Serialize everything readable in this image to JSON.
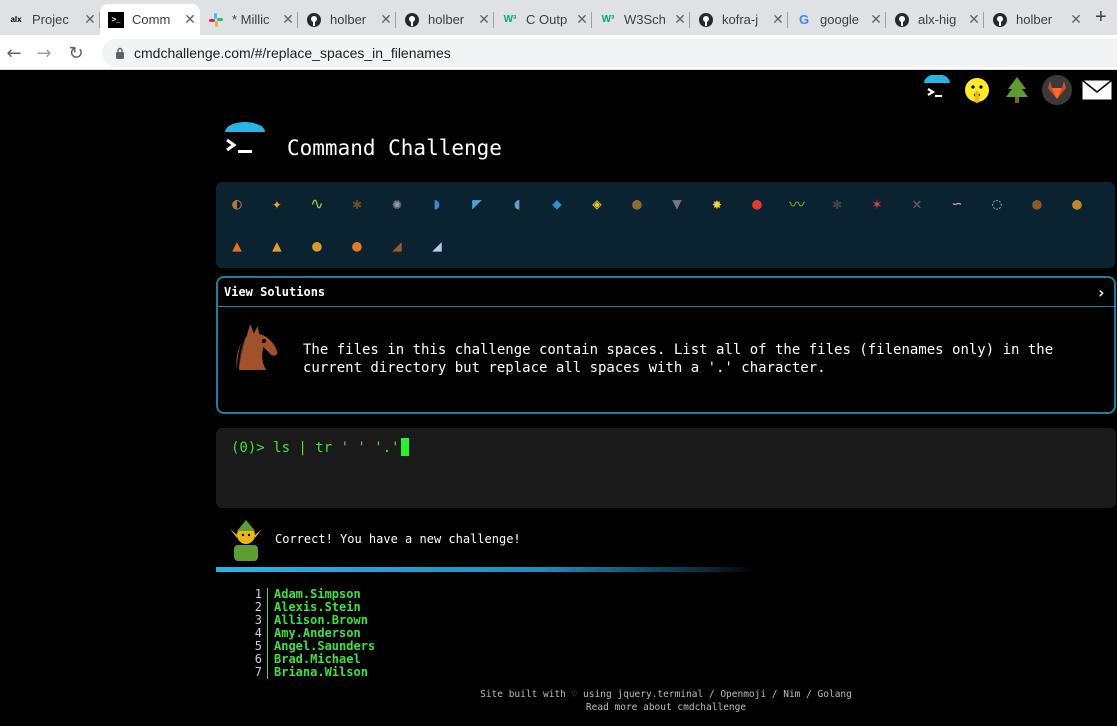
{
  "browser": {
    "tabs": [
      {
        "title": "Projec",
        "favicon": "alx-logo",
        "fav_text": "alx"
      },
      {
        "title": "Comm",
        "favicon": "terminal-logo",
        "fav_text": ">_"
      },
      {
        "title": "* Millic",
        "favicon": "slack-logo",
        "fav_text": ""
      },
      {
        "title": "holber",
        "favicon": "github-logo",
        "fav_text": ""
      },
      {
        "title": "holber",
        "favicon": "github-logo",
        "fav_text": ""
      },
      {
        "title": "C Outp",
        "favicon": "w3schools-logo",
        "fav_text": "W³"
      },
      {
        "title": "W3Sch",
        "favicon": "w3schools-logo",
        "fav_text": "W³"
      },
      {
        "title": "kofra-j",
        "favicon": "github-logo",
        "fav_text": ""
      },
      {
        "title": "google",
        "favicon": "google-logo",
        "fav_text": "G"
      },
      {
        "title": "alx-hig",
        "favicon": "github-logo",
        "fav_text": ""
      },
      {
        "title": "holber",
        "favicon": "github-logo",
        "fav_text": ""
      }
    ],
    "active_tab": 1,
    "new_tab": "+",
    "url": "cmdchallenge.com/#/replace_spaces_in_filenames"
  },
  "header": {
    "title": "Command Challenge",
    "top_icons": [
      "terminal-icon",
      "shushing-face-icon",
      "tree-icon",
      "gitlab-icon",
      "envelope-icon"
    ]
  },
  "emoji_bar": {
    "row1": [
      "snail",
      "butterfly",
      "caterpillar",
      "ant",
      "spider-web",
      "whale",
      "shark",
      "dolphin",
      "fish",
      "tropical-fish",
      "blowfish",
      "wolf",
      "bee",
      "ladybug",
      "lizard",
      "spider",
      "scorpion",
      "fly",
      "worm",
      "microbe",
      "monkey",
      "dog"
    ],
    "row2": [
      "fox",
      "cat",
      "lion",
      "tiger",
      "horse",
      "unicorn"
    ],
    "completed_count": 27,
    "current": "unicorn"
  },
  "challenge": {
    "header_label": "View Solutions",
    "toggle_arrow": "›",
    "icon": "horse-icon",
    "description": "The files in this challenge contain spaces. List all of the files (filenames only) in the current directory but replace all spaces with a '.' character."
  },
  "terminal": {
    "prompt_num": "(0)>",
    "command": " ls | tr ' ' '.'"
  },
  "result": {
    "icon": "elf-icon",
    "message": "Correct! You have a new challenge!"
  },
  "output": [
    {
      "n": "1",
      "v": "Adam.Simpson"
    },
    {
      "n": "2",
      "v": "Alexis.Stein"
    },
    {
      "n": "3",
      "v": "Allison.Brown"
    },
    {
      "n": "4",
      "v": "Amy.Anderson"
    },
    {
      "n": "5",
      "v": "Angel.Saunders"
    },
    {
      "n": "6",
      "v": "Brad.Michael"
    },
    {
      "n": "7",
      "v": "Briana.Wilson"
    }
  ],
  "footer": {
    "line1": "Site built with ♡ using jquery.terminal / Openmoji / Nim / Golang",
    "line2": "Read more about cmdchallenge"
  },
  "colors": {
    "accent": "#1e7fa0",
    "terminal_green": "#3ee23e",
    "emoji_bar_bg": "#0b2330"
  }
}
